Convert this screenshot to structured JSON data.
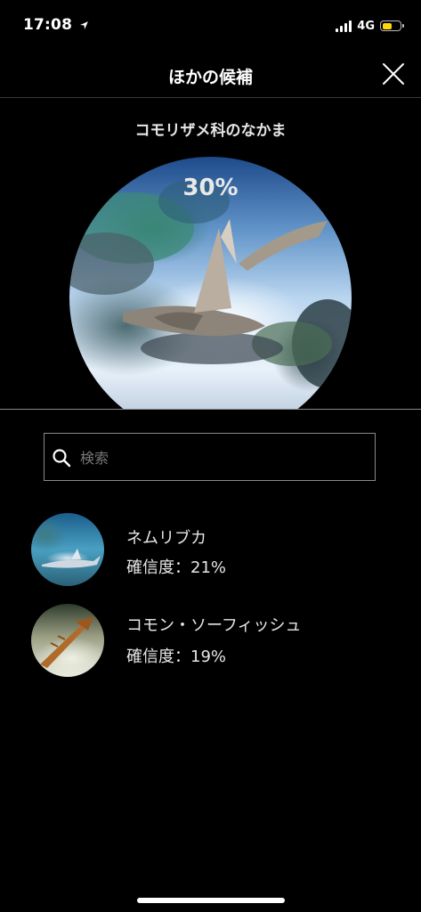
{
  "status_bar": {
    "time": "17:08",
    "network": "4G",
    "battery_level": 0.55,
    "battery_color": "#ffd60a",
    "icons": [
      "location-arrow-icon",
      "cellular-signal-icon",
      "battery-icon"
    ]
  },
  "header": {
    "title": "ほかの候補",
    "close_icon": "close-icon"
  },
  "top_result": {
    "group_title": "コモリザメ科のなかま",
    "confidence": "30%"
  },
  "search": {
    "placeholder": "検索",
    "value": "",
    "icon": "search-icon"
  },
  "candidates": [
    {
      "name": "ネムリブカ",
      "confidence": "確信度：21%"
    },
    {
      "name": "コモン・ソーフィッシュ",
      "confidence": "確信度：19%"
    }
  ],
  "colors": {
    "background": "#000000",
    "text": "#ffffff",
    "divider": "#3a3a3a"
  }
}
